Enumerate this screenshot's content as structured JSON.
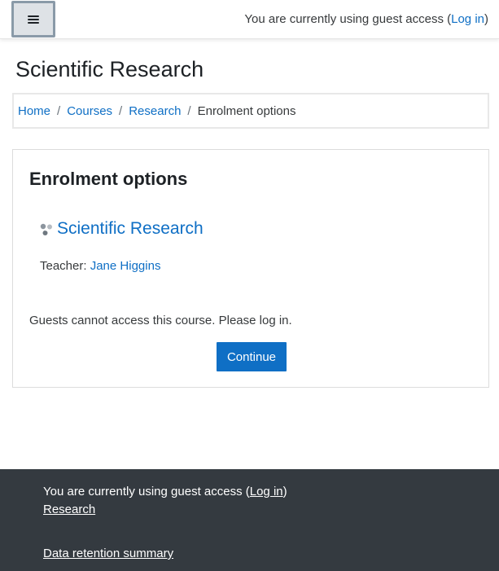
{
  "navbar": {
    "guest_prefix": "You are currently using guest access (",
    "login_link": "Log in",
    "guest_suffix": ")"
  },
  "header": {
    "title": "Scientific Research"
  },
  "breadcrumb": {
    "items": [
      "Home",
      "Courses",
      "Research"
    ],
    "separator": "/",
    "current": "Enrolment options"
  },
  "main": {
    "heading": "Enrolment options",
    "course_name": "Scientific Research",
    "teacher_label": "Teacher:",
    "teacher_name": "Jane Higgins",
    "guest_message": "Guests cannot access this course. Please log in.",
    "continue_label": "Continue"
  },
  "footer": {
    "guest_prefix": "You are currently using guest access (",
    "login_link": "Log in",
    "guest_suffix": ")",
    "course_link": "Research",
    "data_retention": "Data retention summary"
  },
  "colors": {
    "link": "#0f6fc5",
    "footer_bg": "#343a40",
    "button_bg": "#0f6fc5"
  }
}
